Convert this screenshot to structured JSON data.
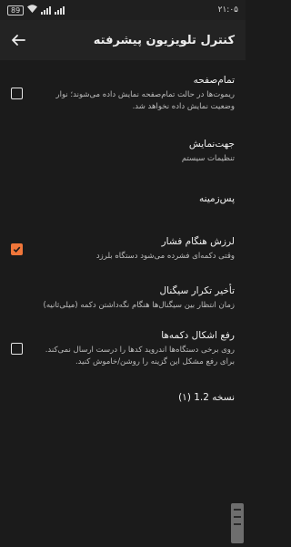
{
  "status_bar": {
    "time": "۲۱:۰۵",
    "battery": "89"
  },
  "app_bar": {
    "title": "کنترل تلویزیون پیشرفته"
  },
  "settings": [
    {
      "title": "تمام‌صفحه",
      "subtitle": "ریموت‌ها در حالت تمام‌صفحه نمایش داده می‌شوند؛ نوار وضعیت نمایش داده نخواهد شد.",
      "checkbox": false
    },
    {
      "title": "جهت‌نمایش",
      "subtitle": "تنظیمات سیستم"
    },
    {
      "title": "پس‌زمینه"
    },
    {
      "title": "لرزش هنگام فشار",
      "subtitle": "وقتی دکمه‌ای فشرده می‌شود دستگاه بلرزد",
      "checkbox": true
    },
    {
      "title": "تأخیر تکرار سیگنال",
      "subtitle": "زمان انتظار بین سیگنال‌ها هنگام نگه‌داشتن دکمه (میلی‌ثانیه)"
    },
    {
      "title": "رفع اشکال دکمه‌ها",
      "subtitle": "روی برخی دستگاه‌ها اندروید کدها را درست ارسال نمی‌کند. برای رفع مشکل این گزینه را روشن/خاموش کنید.",
      "checkbox": false
    },
    {
      "title": "نسخه 1.2 (۱)"
    }
  ],
  "colors": {
    "accent": "#f0763a",
    "background": "#1b1b1b"
  }
}
